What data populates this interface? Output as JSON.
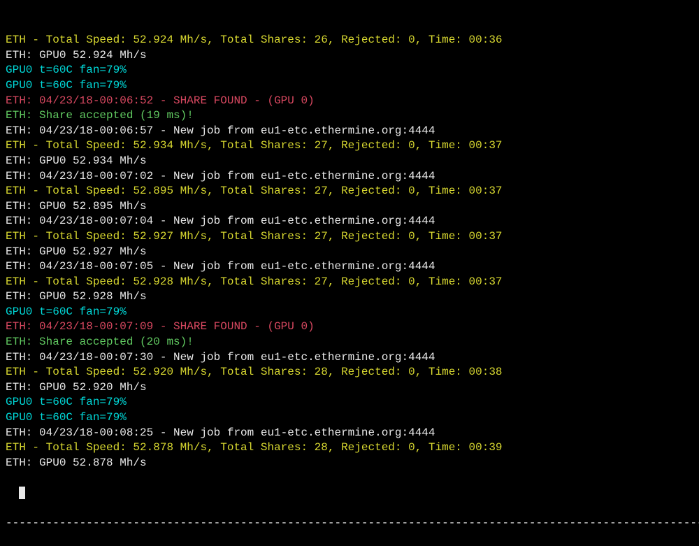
{
  "lines": [
    {
      "cls": "yellow",
      "text": "ETH - Total Speed: 52.924 Mh/s, Total Shares: 26, Rejected: 0, Time: 00:36"
    },
    {
      "cls": "white",
      "text": "ETH: GPU0 52.924 Mh/s"
    },
    {
      "cls": "cyan",
      "text": "GPU0 t=60C fan=79%"
    },
    {
      "cls": "cyan",
      "text": "GPU0 t=60C fan=79%"
    },
    {
      "cls": "red",
      "text": "ETH: 04/23/18-00:06:52 - SHARE FOUND - (GPU 0)"
    },
    {
      "cls": "green",
      "text": "ETH: Share accepted (19 ms)!"
    },
    {
      "cls": "white",
      "text": "ETH: 04/23/18-00:06:57 - New job from eu1-etc.ethermine.org:4444"
    },
    {
      "cls": "yellow",
      "text": "ETH - Total Speed: 52.934 Mh/s, Total Shares: 27, Rejected: 0, Time: 00:37"
    },
    {
      "cls": "white",
      "text": "ETH: GPU0 52.934 Mh/s"
    },
    {
      "cls": "white",
      "text": "ETH: 04/23/18-00:07:02 - New job from eu1-etc.ethermine.org:4444"
    },
    {
      "cls": "yellow",
      "text": "ETH - Total Speed: 52.895 Mh/s, Total Shares: 27, Rejected: 0, Time: 00:37"
    },
    {
      "cls": "white",
      "text": "ETH: GPU0 52.895 Mh/s"
    },
    {
      "cls": "white",
      "text": "ETH: 04/23/18-00:07:04 - New job from eu1-etc.ethermine.org:4444"
    },
    {
      "cls": "yellow",
      "text": "ETH - Total Speed: 52.927 Mh/s, Total Shares: 27, Rejected: 0, Time: 00:37"
    },
    {
      "cls": "white",
      "text": "ETH: GPU0 52.927 Mh/s"
    },
    {
      "cls": "white",
      "text": "ETH: 04/23/18-00:07:05 - New job from eu1-etc.ethermine.org:4444"
    },
    {
      "cls": "yellow",
      "text": "ETH - Total Speed: 52.928 Mh/s, Total Shares: 27, Rejected: 0, Time: 00:37"
    },
    {
      "cls": "white",
      "text": "ETH: GPU0 52.928 Mh/s"
    },
    {
      "cls": "cyan",
      "text": "GPU0 t=60C fan=79%"
    },
    {
      "cls": "red",
      "text": "ETH: 04/23/18-00:07:09 - SHARE FOUND - (GPU 0)"
    },
    {
      "cls": "green",
      "text": "ETH: Share accepted (20 ms)!"
    },
    {
      "cls": "white",
      "text": "ETH: 04/23/18-00:07:30 - New job from eu1-etc.ethermine.org:4444"
    },
    {
      "cls": "yellow",
      "text": "ETH - Total Speed: 52.920 Mh/s, Total Shares: 28, Rejected: 0, Time: 00:38"
    },
    {
      "cls": "white",
      "text": "ETH: GPU0 52.920 Mh/s"
    },
    {
      "cls": "cyan",
      "text": "GPU0 t=60C fan=79%"
    },
    {
      "cls": "cyan",
      "text": "GPU0 t=60C fan=79%"
    },
    {
      "cls": "white",
      "text": "ETH: 04/23/18-00:08:25 - New job from eu1-etc.ethermine.org:4444"
    },
    {
      "cls": "yellow",
      "text": "ETH - Total Speed: 52.878 Mh/s, Total Shares: 28, Rejected: 0, Time: 00:39"
    },
    {
      "cls": "white",
      "text": "ETH: GPU0 52.878 Mh/s"
    }
  ],
  "separator": "------------------------------------------------------------------------------------------------------------"
}
